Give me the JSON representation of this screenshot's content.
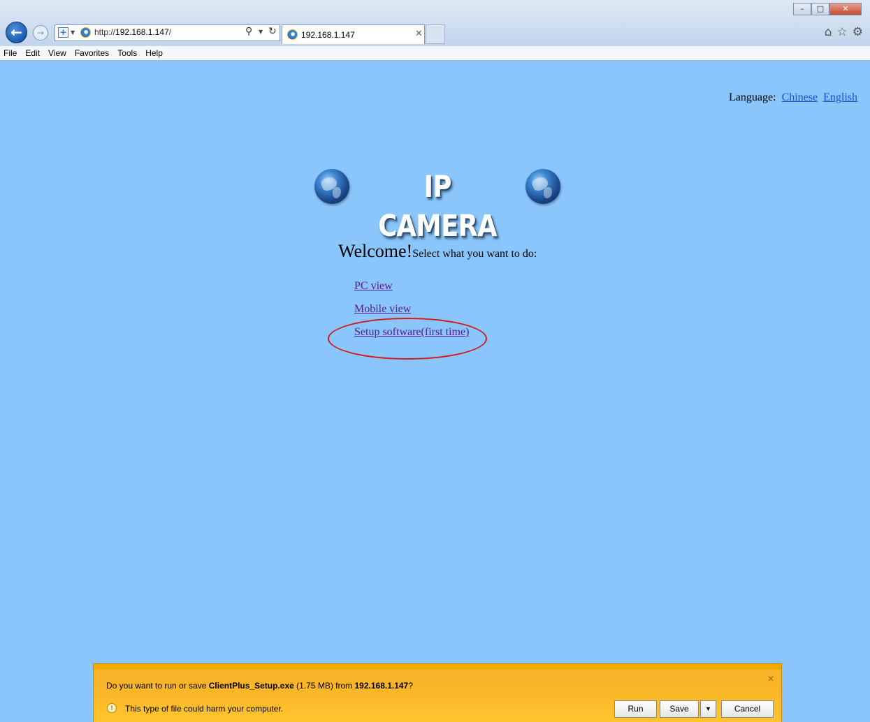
{
  "browser": {
    "url_prefix": "http://",
    "url_host": "192.168.1.147",
    "url_suffix": "/",
    "tab_title": "192.168.1.147",
    "menu": [
      "File",
      "Edit",
      "View",
      "Favorites",
      "Tools",
      "Help"
    ]
  },
  "page": {
    "language_label": "Language:",
    "language_options": [
      "Chinese",
      "English"
    ],
    "logo_text": "IP CAMERA",
    "welcome_big": "Welcome!",
    "welcome_small": "Select what you want to do:",
    "links": [
      "PC view",
      "Mobile view",
      "Setup software(first time)"
    ]
  },
  "download": {
    "prefix": "Do you want to run or save ",
    "filename": "ClientPlus_Setup.exe",
    "size": " (1.75 MB) from ",
    "host": "192.168.1.147",
    "suffix": "?",
    "warning": "This type of file could harm your computer.",
    "run_label": "Run",
    "save_label": "Save",
    "cancel_label": "Cancel"
  },
  "colors": {
    "page_background": "#8ac5fb",
    "link_visited": "#5b1a8c",
    "link": "#1a4fcf",
    "highlight": "#d21a1a",
    "download_bar": "#f8b327"
  }
}
